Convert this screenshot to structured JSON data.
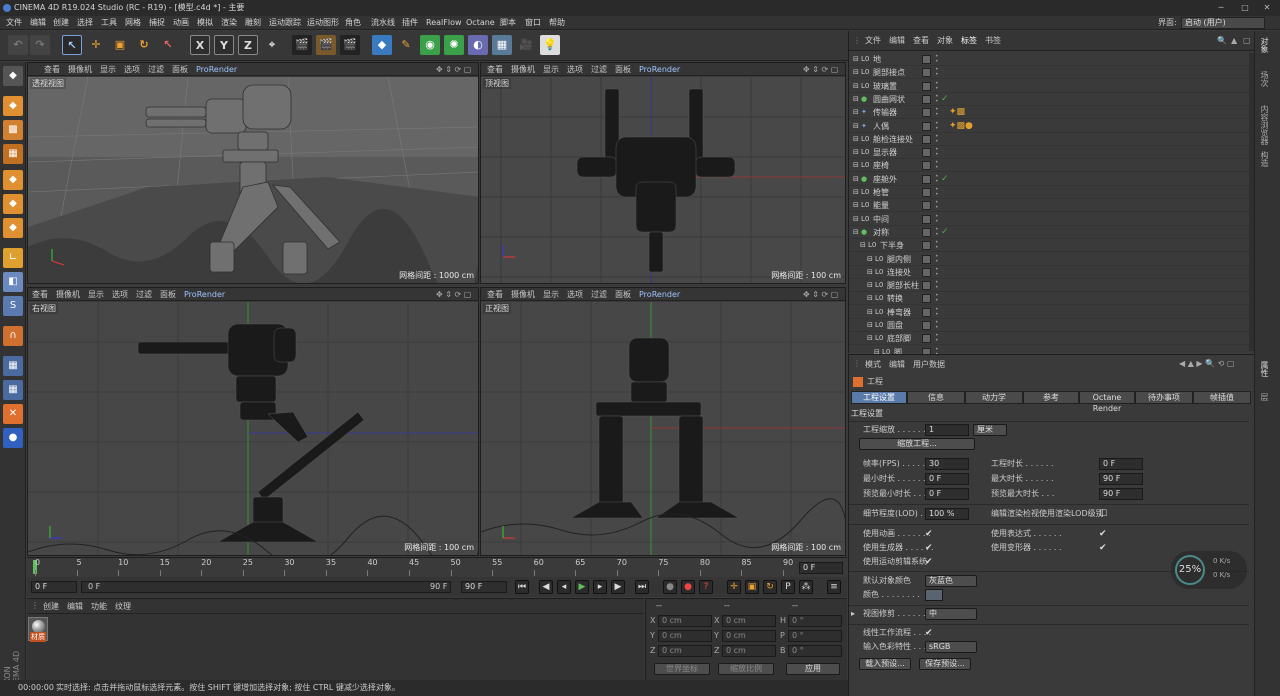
{
  "title": "CINEMA 4D R19.024 Studio (RC - R19) - [模型.c4d *] - 主要",
  "menu": [
    "文件",
    "编辑",
    "创建",
    "选择",
    "工具",
    "网格",
    "捕捉",
    "动画",
    "模拟",
    "渲染",
    "雕刻",
    "运动跟踪",
    "运动图形",
    "角色",
    "流水线",
    "插件",
    "RealFlow",
    "Octane",
    "脚本",
    "窗口",
    "帮助"
  ],
  "interface_label": "界面:",
  "interface_value": "启动 (用户)",
  "viewport_menu": [
    "查看",
    "摄像机",
    "显示",
    "选项",
    "过滤",
    "面板",
    "ProRender"
  ],
  "viewports": [
    {
      "name": "透视视图",
      "grid": "网格间距 : 1000 cm"
    },
    {
      "name": "顶视图",
      "grid": "网格间距 : 100 cm"
    },
    {
      "name": "右视图",
      "grid": "网格间距 : 100 cm"
    },
    {
      "name": "正视图",
      "grid": "网格间距 : 100 cm"
    }
  ],
  "timeline": {
    "ticks": [
      "0",
      "5",
      "10",
      "15",
      "20",
      "25",
      "30",
      "35",
      "40",
      "45",
      "50",
      "55",
      "60",
      "65",
      "70",
      "75",
      "80",
      "85",
      "90"
    ],
    "frame_end": "0 F"
  },
  "transport": {
    "start": "0 F",
    "range_start": "0 F",
    "range_end": "90 F",
    "end": "90 F"
  },
  "material_tabs": [
    "创建",
    "编辑",
    "功能",
    "纹理"
  ],
  "material_name": "材质",
  "coords": {
    "header": [
      "--",
      "--",
      "--"
    ],
    "rows": [
      {
        "a": "X",
        "av": "0 cm",
        "b": "X",
        "bv": "0 cm",
        "c": "H",
        "cv": "0 °"
      },
      {
        "a": "Y",
        "av": "0 cm",
        "b": "Y",
        "bv": "0 cm",
        "c": "P",
        "cv": "0 °"
      },
      {
        "a": "Z",
        "av": "0 cm",
        "b": "Z",
        "bv": "0 cm",
        "c": "B",
        "cv": "0 °"
      }
    ],
    "world": "世界坐标",
    "scale": "缩放比例",
    "apply": "应用"
  },
  "status": {
    "time": "00:00:00",
    "text": "实时选择: 点击并拖动鼠标选择元素。按住 SHIFT 键增加选择对象; 按住 CTRL 键减少选择对象。"
  },
  "objmgr_menu": [
    "文件",
    "编辑",
    "查看",
    "对象",
    "标签",
    "书签"
  ],
  "objects": [
    {
      "name": "地",
      "indent": 0,
      "icon": "L0",
      "check": false
    },
    {
      "name": "腿部接点",
      "indent": 0,
      "icon": "L0",
      "check": false
    },
    {
      "name": "玻璃置",
      "indent": 0,
      "icon": "L0",
      "check": false
    },
    {
      "name": "圆曲网状",
      "indent": 0,
      "icon": "●",
      "check": true
    },
    {
      "name": "传输器",
      "indent": 0,
      "icon": "✦",
      "check": false
    },
    {
      "name": "人偶",
      "indent": 0,
      "icon": "✦",
      "check": false
    },
    {
      "name": "舱检连接处",
      "indent": 0,
      "icon": "L0",
      "check": false
    },
    {
      "name": "显示器",
      "indent": 0,
      "icon": "L0",
      "check": false
    },
    {
      "name": "座椅",
      "indent": 0,
      "icon": "L0",
      "check": false
    },
    {
      "name": "座舱外",
      "indent": 0,
      "icon": "●",
      "check": true
    },
    {
      "name": "枪管",
      "indent": 0,
      "icon": "L0",
      "check": false
    },
    {
      "name": "能量",
      "indent": 0,
      "icon": "L0",
      "check": false
    },
    {
      "name": "中间",
      "indent": 0,
      "icon": "L0",
      "check": false
    },
    {
      "name": "对称",
      "indent": 0,
      "icon": "●",
      "check": true
    },
    {
      "name": "下半身",
      "indent": 1,
      "icon": "L0",
      "check": false
    },
    {
      "name": "腿内侧",
      "indent": 2,
      "icon": "L0",
      "check": false
    },
    {
      "name": "连接处",
      "indent": 2,
      "icon": "L0",
      "check": false
    },
    {
      "name": "腿部长柱",
      "indent": 2,
      "icon": "L0",
      "check": false
    },
    {
      "name": "转换",
      "indent": 2,
      "icon": "L0",
      "check": false
    },
    {
      "name": "棒弯器",
      "indent": 2,
      "icon": "L0",
      "check": false
    },
    {
      "name": "圆盘",
      "indent": 2,
      "icon": "L0",
      "check": false
    },
    {
      "name": "底部脚",
      "indent": 2,
      "icon": "L0",
      "check": false
    },
    {
      "name": "脚",
      "indent": 3,
      "icon": "L0",
      "check": false
    }
  ],
  "right_tabs": [
    "对象",
    "场次",
    "内容浏览器",
    "构造"
  ],
  "attr_menu": [
    "模式",
    "编辑",
    "用户数据"
  ],
  "attr_title": "工程",
  "attr_tabs": [
    "工程设置",
    "信息",
    "动力学",
    "参考",
    "Octane Render",
    "待办事项",
    "帧插值"
  ],
  "attr_section": "工程设置",
  "attr": {
    "scale_label": "工程缩放 . . . . . .",
    "scale_value": "1",
    "scale_unit": "厘米",
    "scale_btn": "缩放工程...",
    "fps_label": "帧率(FPS) . . . . . .",
    "fps": "30",
    "duration_label": "工程时长 . . . . . .",
    "duration": "0 F",
    "min_label": "最小时长 . . . . . .",
    "min": "0 F",
    "max_label": "最大时长 . . . . . .",
    "max": "90 F",
    "pmin_label": "预览最小时长 . . .",
    "pmin": "0 F",
    "pmax_label": "预览最大时长 . . .",
    "pmax": "90 F",
    "lod_label": "细节程度(LOD) . . .",
    "lod": "100 %",
    "lod_render_label": "编辑渲染检视使用渲染LOD级别",
    "anim_label": "使用动画 . . . . . . .",
    "expr_label": "使用表达式 . . . . . .",
    "gen_label": "使用生成器 . . . . . .",
    "deform_label": "使用变形器 . . . . . .",
    "motion_label": "使用运动剪辑系统",
    "objcolor_label": "默认对象颜色",
    "objcolor": "灰蓝色",
    "color_label": "颜色 . . . . . . . .",
    "clip_label": "视图修剪 . . . . . .",
    "clip": "中",
    "linear_label": "线性工作流程 . . . .",
    "input_label": "输入色彩特性 . . .",
    "input": "sRGB",
    "load_btn": "载入预设...",
    "save_btn": "保存预设..."
  },
  "hud": {
    "percent": "25%",
    "up": "0 K/s",
    "down": "0 K/s"
  }
}
